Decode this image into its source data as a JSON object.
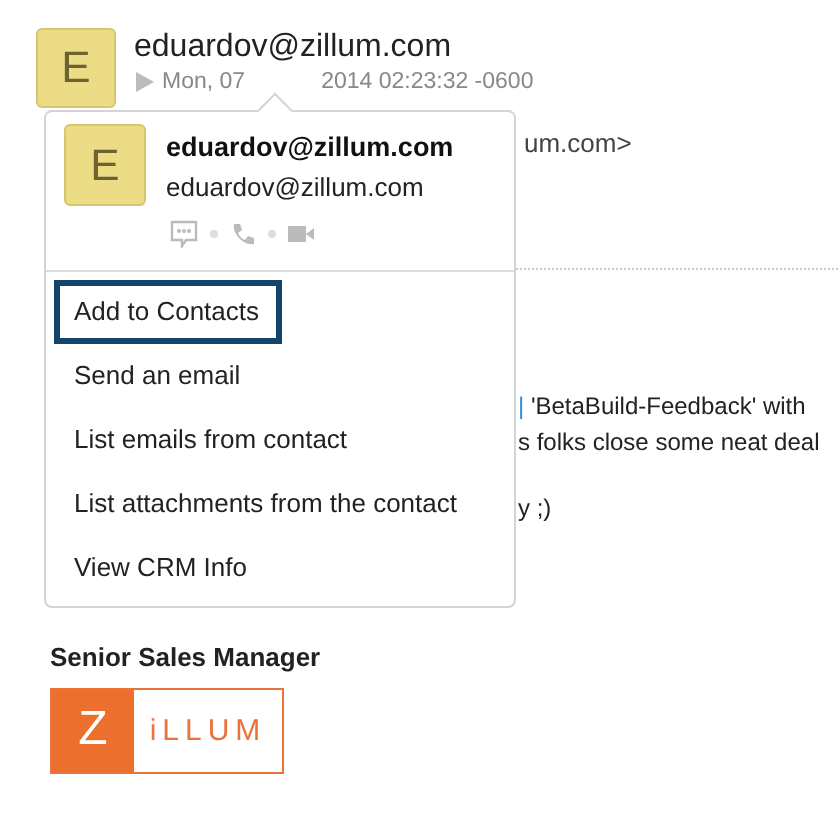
{
  "message": {
    "avatar_letter": "E",
    "sender": "eduardov@zillum.com",
    "date_start": "Mon, 07",
    "date_end": "2014 02:23:32 -0600",
    "recipient_end": "um.com>",
    "body_lines": [
      {
        "kind": "link",
        "link": "|",
        "text": " 'BetaBuild-Feedback' with"
      },
      {
        "kind": "plain",
        "text": "s folks close some neat deal"
      },
      {
        "kind": "plain",
        "text": "y ;)"
      }
    ],
    "signature": "Senior Sales Manager",
    "logo": {
      "mark": "Z",
      "word": "iLLUM"
    }
  },
  "popover": {
    "avatar_letter": "E",
    "name": "eduardov@zillum.com",
    "email": "eduardov@zillum.com",
    "actions": [
      {
        "kind": "chat"
      },
      {
        "kind": "phone"
      },
      {
        "kind": "video"
      }
    ],
    "menu": [
      {
        "label": "Add to Contacts",
        "selected": true
      },
      {
        "label": "Send an email",
        "selected": false
      },
      {
        "label": "List emails from contact",
        "selected": false
      },
      {
        "label": "List attachments from the contact",
        "selected": false
      },
      {
        "label": "View CRM Info",
        "selected": false
      }
    ]
  }
}
